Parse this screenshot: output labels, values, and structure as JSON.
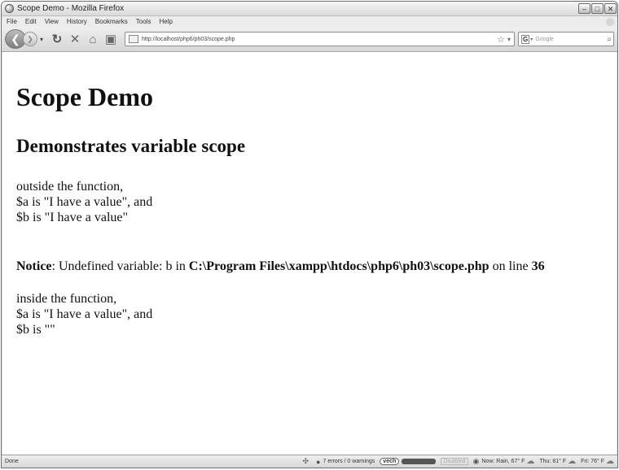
{
  "window": {
    "title": "Scope Demo - Mozilla Firefox",
    "minimize": "–",
    "maximize": "□",
    "close": "✕"
  },
  "menu": [
    "File",
    "Edit",
    "View",
    "History",
    "Bookmarks",
    "Tools",
    "Help"
  ],
  "nav": {
    "url": "http://localhost/php6/ph03/scope.php",
    "search_placeholder": "Google",
    "search_engine_letter": "G"
  },
  "page": {
    "h1": "Scope Demo",
    "h2": "Demonstrates variable scope",
    "outside": [
      "outside the function,",
      "$a is \"I have a value\", and",
      "$b is \"I have a value\""
    ],
    "notice": {
      "label": "Notice",
      "text": ": Undefined variable: b in ",
      "path": "C:\\Program Files\\xampp\\htdocs\\php6\\ph03\\scope.php",
      "online": " on line ",
      "line": "36"
    },
    "inside": [
      "inside the function,",
      "$a is \"I have a value\", and",
      "$b is \"\""
    ]
  },
  "status": {
    "done": "Done",
    "errors": "7 errors / 0 warnings",
    "vech": "vech",
    "disabled": "Disabled",
    "now": "Now: Rain, 67° F",
    "thu": "Thu: 81° F",
    "fri": "Fri: 76° F"
  }
}
